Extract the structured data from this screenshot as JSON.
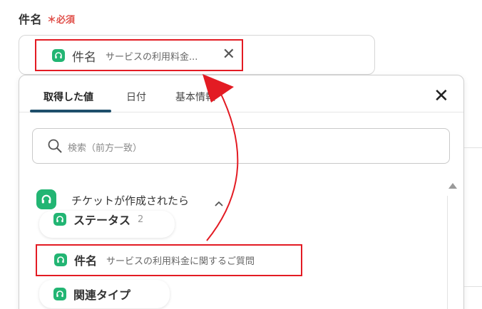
{
  "field": {
    "label": "件名",
    "required_mark": "＊",
    "required_text": "必須"
  },
  "selected_chip": {
    "key": "件名",
    "value": "サービスの利用料金..."
  },
  "tabs": [
    {
      "label": "取得した値",
      "active": true
    },
    {
      "label": "日付",
      "active": false
    },
    {
      "label": "基本情報",
      "active": false
    }
  ],
  "search": {
    "placeholder": "検索（前方一致）"
  },
  "group": {
    "label": "チケットが作成されたら"
  },
  "items": [
    {
      "key": "ステータス",
      "value": "2"
    },
    {
      "key": "件名",
      "value": "サービスの利用料金に関するご質問"
    },
    {
      "key": "関連タイプ",
      "value": ""
    }
  ],
  "icons": {
    "app": "headset-icon",
    "close": "close-icon",
    "remove": "remove-x-icon",
    "search": "search-icon",
    "chevron": "chevron-up-icon"
  },
  "colors": {
    "app_green": "#22b573",
    "highlight_red": "#e31b23",
    "active_tab": "#1e4f6b",
    "required": "#e0504a"
  }
}
